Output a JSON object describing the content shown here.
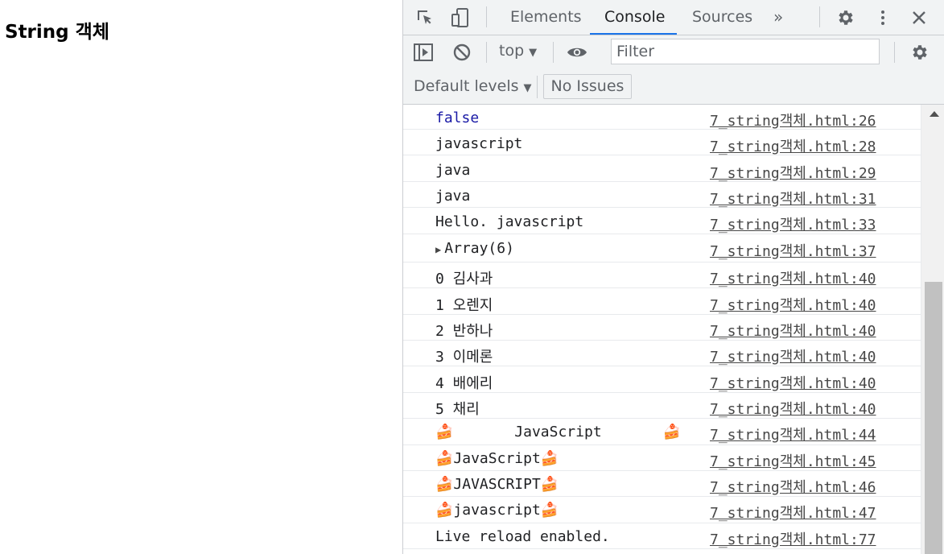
{
  "page": {
    "title": "String 객체"
  },
  "devtools": {
    "tabs": [
      {
        "label": "Elements"
      },
      {
        "label": "Console"
      },
      {
        "label": "Sources"
      }
    ],
    "more_tabs": "»",
    "context": "top",
    "filter_placeholder": "Filter",
    "levels": "Default levels",
    "issues": "No Issues",
    "accent": "#1a73e8"
  },
  "console": {
    "rows": [
      {
        "text": "false",
        "source": "7_string객체.html:26"
      },
      {
        "text": "javascript",
        "source": "7_string객체.html:28"
      },
      {
        "text": "java",
        "source": "7_string객체.html:29"
      },
      {
        "text": "java",
        "source": "7_string객체.html:31"
      },
      {
        "text": "Hello. javascript",
        "source": "7_string객체.html:33"
      },
      {
        "text": "Array(6)",
        "source": "7_string객체.html:37"
      },
      {
        "text": "0 김사과",
        "source": "7_string객체.html:40"
      },
      {
        "text": "1 오렌지",
        "source": "7_string객체.html:40"
      },
      {
        "text": "2 반하나",
        "source": "7_string객체.html:40"
      },
      {
        "text": "3 이메론",
        "source": "7_string객체.html:40"
      },
      {
        "text": "4 배에리",
        "source": "7_string객체.html:40"
      },
      {
        "text": "5 채리",
        "source": "7_string객체.html:40"
      },
      {
        "text": "       JavaScript       ",
        "source": "7_string객체.html:44"
      },
      {
        "text": "JavaScript",
        "source": "7_string객체.html:45"
      },
      {
        "text": "JAVASCRIPT",
        "source": "7_string객체.html:46"
      },
      {
        "text": "javascript",
        "source": "7_string객체.html:47"
      },
      {
        "text": "Live reload enabled.",
        "source": "7_string객체.html:77"
      }
    ]
  }
}
